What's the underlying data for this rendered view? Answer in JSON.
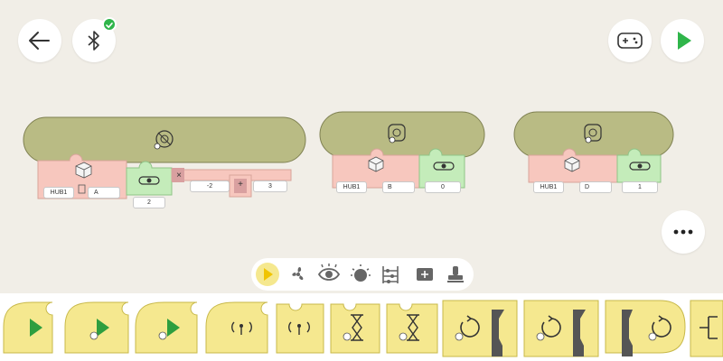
{
  "colors": {
    "background": "#f1eee7",
    "hat_block": "#b9bb84",
    "motor_block": "#f7c7be",
    "speed_block": "#c4ecba",
    "operator_block": "#f0a0a0",
    "event_block": "#f5e88f",
    "accent_green": "#2fb54a"
  },
  "top_bar": {
    "back_icon": "back-arrow-icon",
    "bluetooth_icon": "bluetooth-icon",
    "bluetooth_connected": true,
    "controller_icon": "gamepad-icon",
    "run_icon": "play-icon"
  },
  "canvas": {
    "stack1": {
      "hub_label": "HUB1",
      "port_label": "A",
      "speed_value": "2",
      "operand_a": "-2",
      "operand_b": "3",
      "operator_times": "×",
      "operator_plus": "+"
    },
    "stack2": {
      "hub_label": "HUB1",
      "port_label": "B",
      "speed_value": "0"
    },
    "stack3": {
      "hub_label": "HUB1",
      "port_label": "D",
      "speed_value": "1"
    }
  },
  "more_button_icon": "more-dots-icon",
  "palette": {
    "categories": [
      "events",
      "motors",
      "sensors",
      "light",
      "operators",
      "sound",
      "more"
    ],
    "selected": "events"
  },
  "block_tray": {
    "blocks": [
      "start-on-play",
      "start-on-condition",
      "start-on-condition-advanced",
      "broadcast-receive",
      "broadcast-send",
      "wait-timer",
      "wait-until",
      "repeat-count",
      "repeat-until",
      "repeat-forever",
      "branch"
    ]
  }
}
